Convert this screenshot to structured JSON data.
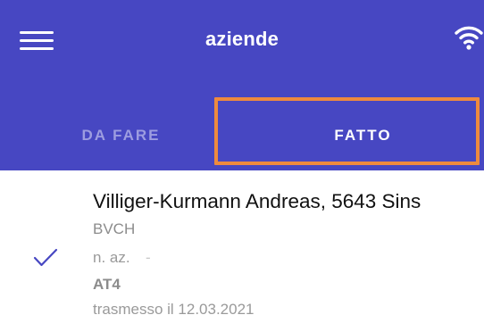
{
  "header": {
    "title": "aziende",
    "menu_icon": "hamburger-menu-icon",
    "status_icon": "wifi-icon",
    "background_color": "#4747c2"
  },
  "tabs": [
    {
      "label": "DA FARE",
      "active": false
    },
    {
      "label": "FATTO",
      "active": true
    }
  ],
  "tab_highlight_color": "#ee8a3e",
  "list": {
    "items": [
      {
        "status_icon": "checkmark-icon",
        "name": "Villiger-Kurmann Andreas, 5643 Sins",
        "organization": "BVCH",
        "naz_label": "n. az.",
        "naz_value": "-",
        "code": "AT4",
        "sent": "trasmesso il 12.03.2021"
      }
    ]
  }
}
